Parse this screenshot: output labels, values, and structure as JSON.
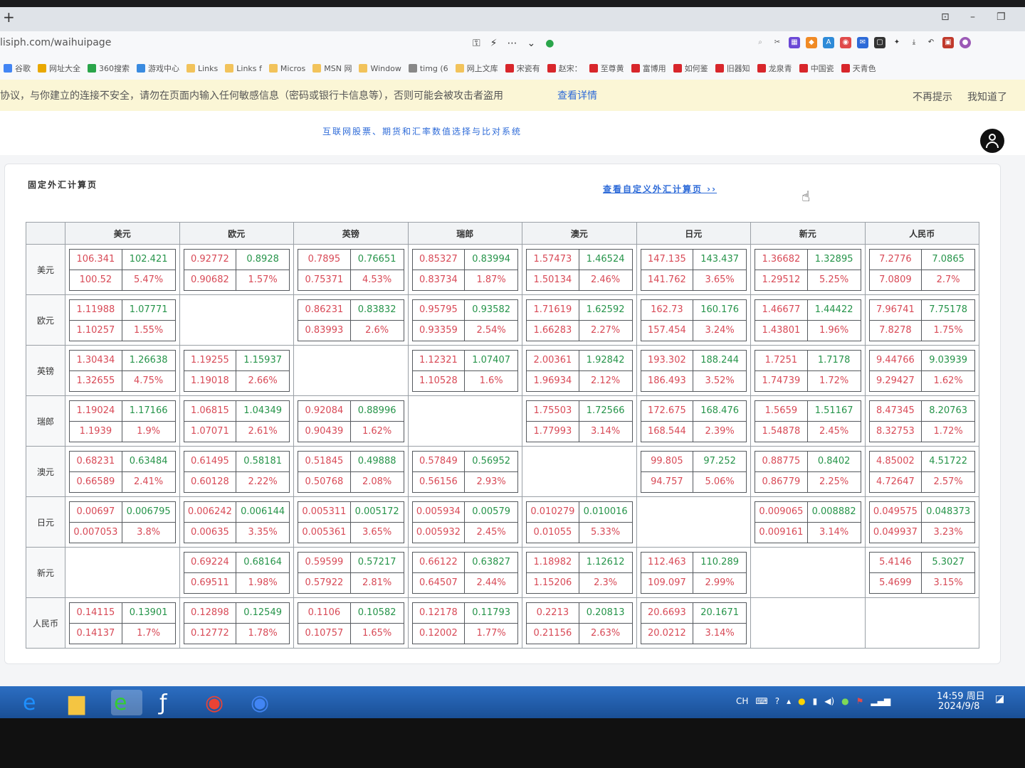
{
  "browser": {
    "url": "lisiph.com/waihuipage",
    "bookmarks": [
      {
        "label": "谷歌",
        "color": "#4285f4"
      },
      {
        "label": "网址大全",
        "color": "#e9a800"
      },
      {
        "label": "360搜索",
        "color": "#2aa54a"
      },
      {
        "label": "游戏中心",
        "color": "#3a8be0"
      },
      {
        "label": "Links",
        "color": "#f2c35b"
      },
      {
        "label": "Links f",
        "color": "#f2c35b"
      },
      {
        "label": "Micros",
        "color": "#f2c35b"
      },
      {
        "label": "MSN 网",
        "color": "#f2c35b"
      },
      {
        "label": "Window",
        "color": "#f2c35b"
      },
      {
        "label": "timg (6",
        "color": "#888888"
      },
      {
        "label": "网上文库",
        "color": "#f2c35b"
      },
      {
        "label": "宋瓷有",
        "color": "#d8262b"
      },
      {
        "label": "赵宋：",
        "color": "#d8262b"
      },
      {
        "label": "至尊黄",
        "color": "#d8262b"
      },
      {
        "label": "富博用",
        "color": "#d8262b"
      },
      {
        "label": "如何鉴",
        "color": "#d8262b"
      },
      {
        "label": "旧器知",
        "color": "#d8262b"
      },
      {
        "label": "龙泉青",
        "color": "#d8262b"
      },
      {
        "label": "中国瓷",
        "color": "#d8262b"
      },
      {
        "label": "天青色",
        "color": "#d8262b"
      }
    ],
    "warning": {
      "text": "协议，与你建立的连接不安全，请勿在页面内输入任何敏感信息（密码或银行卡信息等），否则可能会被攻击者盗用",
      "link": "查看详情",
      "dismiss": "不再提示",
      "ok": "我知道了"
    }
  },
  "page": {
    "site_title": "互联网股票、期货和汇率数值选择与比对系统",
    "card_title": "固定外汇计算页",
    "custom_link": "查看自定义外汇计算页 ››"
  },
  "colors": {
    "sell": "#d84a57",
    "buy": "#26944a",
    "border": "#55595e"
  },
  "currencies": [
    "美元",
    "欧元",
    "英镑",
    "瑞郎",
    "澳元",
    "日元",
    "新元",
    "人民币"
  ],
  "rates": [
    [
      [
        "106.341",
        "102.421",
        "100.52",
        "5.47%"
      ],
      [
        "0.92772",
        "0.8928",
        "0.90682",
        "1.57%"
      ],
      [
        "0.7895",
        "0.76651",
        "0.75371",
        "4.53%"
      ],
      [
        "0.85327",
        "0.83994",
        "0.83734",
        "1.87%"
      ],
      [
        "1.57473",
        "1.46524",
        "1.50134",
        "2.46%"
      ],
      [
        "147.135",
        "143.437",
        "141.762",
        "3.65%"
      ],
      [
        "1.36682",
        "1.32895",
        "1.29512",
        "5.25%"
      ],
      [
        "7.2776",
        "7.0865",
        "7.0809",
        "2.7%"
      ]
    ],
    [
      [
        "1.11988",
        "1.07771",
        "1.10257",
        "1.55%"
      ],
      null,
      [
        "0.86231",
        "0.83832",
        "0.83993",
        "2.6%"
      ],
      [
        "0.95795",
        "0.93582",
        "0.93359",
        "2.54%"
      ],
      [
        "1.71619",
        "1.62592",
        "1.66283",
        "2.27%"
      ],
      [
        "162.73",
        "160.176",
        "157.454",
        "3.24%"
      ],
      [
        "1.46677",
        "1.44422",
        "1.43801",
        "1.96%"
      ],
      [
        "7.96741",
        "7.75178",
        "7.8278",
        "1.75%"
      ]
    ],
    [
      [
        "1.30434",
        "1.26638",
        "1.32655",
        "4.75%"
      ],
      [
        "1.19255",
        "1.15937",
        "1.19018",
        "2.66%"
      ],
      null,
      [
        "1.12321",
        "1.07407",
        "1.10528",
        "1.6%"
      ],
      [
        "2.00361",
        "1.92842",
        "1.96934",
        "2.12%"
      ],
      [
        "193.302",
        "188.244",
        "186.493",
        "3.52%"
      ],
      [
        "1.7251",
        "1.7178",
        "1.74739",
        "1.72%"
      ],
      [
        "9.44766",
        "9.03939",
        "9.29427",
        "1.62%"
      ]
    ],
    [
      [
        "1.19024",
        "1.17166",
        "1.1939",
        "1.9%"
      ],
      [
        "1.06815",
        "1.04349",
        "1.07071",
        "2.61%"
      ],
      [
        "0.92084",
        "0.88996",
        "0.90439",
        "1.62%"
      ],
      null,
      [
        "1.75503",
        "1.72566",
        "1.77993",
        "3.14%"
      ],
      [
        "172.675",
        "168.476",
        "168.544",
        "2.39%"
      ],
      [
        "1.5659",
        "1.51167",
        "1.54878",
        "2.45%"
      ],
      [
        "8.47345",
        "8.20763",
        "8.32753",
        "1.72%"
      ]
    ],
    [
      [
        "0.68231",
        "0.63484",
        "0.66589",
        "2.41%"
      ],
      [
        "0.61495",
        "0.58181",
        "0.60128",
        "2.22%"
      ],
      [
        "0.51845",
        "0.49888",
        "0.50768",
        "2.08%"
      ],
      [
        "0.57849",
        "0.56952",
        "0.56156",
        "2.93%"
      ],
      null,
      [
        "99.805",
        "97.252",
        "94.757",
        "5.06%"
      ],
      [
        "0.88775",
        "0.8402",
        "0.86779",
        "2.25%"
      ],
      [
        "4.85002",
        "4.51722",
        "4.72647",
        "2.57%"
      ]
    ],
    [
      [
        "0.00697",
        "0.006795",
        "0.007053",
        "3.8%"
      ],
      [
        "0.006242",
        "0.006144",
        "0.00635",
        "3.35%"
      ],
      [
        "0.005311",
        "0.005172",
        "0.005361",
        "3.65%"
      ],
      [
        "0.005934",
        "0.00579",
        "0.005932",
        "2.45%"
      ],
      [
        "0.010279",
        "0.010016",
        "0.01055",
        "5.33%"
      ],
      null,
      [
        "0.009065",
        "0.008882",
        "0.009161",
        "3.14%"
      ],
      [
        "0.049575",
        "0.048373",
        "0.049937",
        "3.23%"
      ]
    ],
    [
      null,
      [
        "0.69224",
        "0.68164",
        "0.69511",
        "1.98%"
      ],
      [
        "0.59599",
        "0.57217",
        "0.57922",
        "2.81%"
      ],
      [
        "0.66122",
        "0.63827",
        "0.64507",
        "2.44%"
      ],
      [
        "1.18982",
        "1.12612",
        "1.15206",
        "2.3%"
      ],
      [
        "112.463",
        "110.289",
        "109.097",
        "2.99%"
      ],
      null,
      [
        "5.4146",
        "5.3027",
        "5.4699",
        "3.15%"
      ]
    ],
    [
      [
        "0.14115",
        "0.13901",
        "0.14137",
        "1.7%"
      ],
      [
        "0.12898",
        "0.12549",
        "0.12772",
        "1.78%"
      ],
      [
        "0.1106",
        "0.10582",
        "0.10757",
        "1.65%"
      ],
      [
        "0.12178",
        "0.11793",
        "0.12002",
        "1.77%"
      ],
      [
        "0.2213",
        "0.20813",
        "0.21156",
        "2.63%"
      ],
      [
        "20.6693",
        "20.1671",
        "20.0212",
        "3.14%"
      ],
      null,
      null
    ]
  ],
  "taskbar": {
    "apps": [
      {
        "name": "ie-icon",
        "glyph": "e",
        "color": "#1e90ff"
      },
      {
        "name": "folder-icon",
        "glyph": "▆",
        "color": "#f4c542"
      },
      {
        "name": "browser-e-icon",
        "glyph": "e",
        "color": "#33cc33"
      },
      {
        "name": "flash-icon",
        "glyph": "ƒ",
        "color": "#ffffff"
      },
      {
        "name": "chrome-icon",
        "glyph": "◉",
        "color": "#ea4335"
      },
      {
        "name": "chrome-icon-2",
        "glyph": "◉",
        "color": "#4285f4"
      }
    ],
    "lang": "CH",
    "time": "14:59 周日",
    "date": "2024/9/8"
  }
}
